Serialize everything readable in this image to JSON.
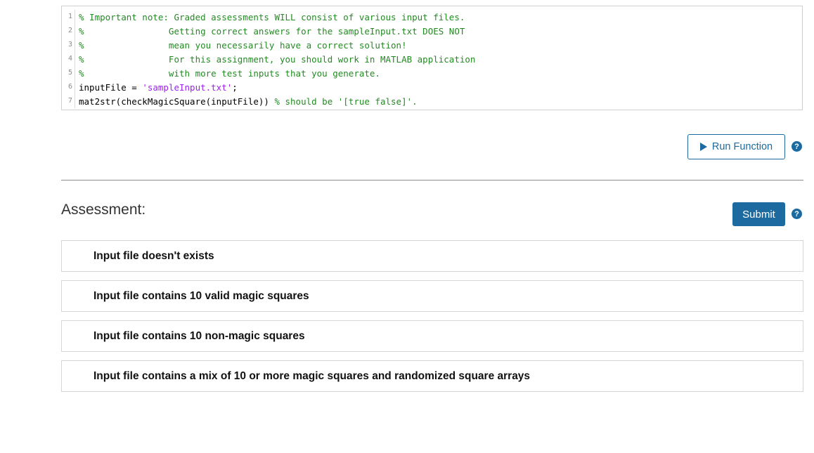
{
  "code": {
    "lines": [
      {
        "num": "1",
        "parts": [
          {
            "cls": "cmt",
            "text": "% Important note: Graded assessments WILL consist of various input files."
          }
        ]
      },
      {
        "num": "2",
        "parts": [
          {
            "cls": "cmt",
            "text": "%                Getting correct answers for the sampleInput.txt DOES NOT"
          }
        ]
      },
      {
        "num": "3",
        "parts": [
          {
            "cls": "cmt",
            "text": "%                mean you necessarily have a correct solution!"
          }
        ]
      },
      {
        "num": "4",
        "parts": [
          {
            "cls": "cmt",
            "text": "%                For this assignment, you should work in MATLAB application"
          }
        ]
      },
      {
        "num": "5",
        "parts": [
          {
            "cls": "cmt",
            "text": "%                with more test inputs that you generate."
          }
        ]
      },
      {
        "num": "6",
        "parts": [
          {
            "cls": "txt",
            "text": "inputFile = "
          },
          {
            "cls": "str",
            "text": "'sampleInput.txt'"
          },
          {
            "cls": "txt",
            "text": ";"
          }
        ]
      },
      {
        "num": "7",
        "parts": [
          {
            "cls": "txt",
            "text": "mat2str(checkMagicSquare(inputFile)) "
          },
          {
            "cls": "cmt",
            "text": "% should be '[true false]'."
          }
        ]
      }
    ]
  },
  "run_button": {
    "label": "Run Function"
  },
  "help_icon_glyph": "?",
  "assessment": {
    "title": "Assessment:",
    "submit_label": "Submit",
    "tests": [
      "Input file doesn't exists",
      "Input file contains 10 valid magic squares",
      "Input file contains 10 non-magic squares",
      "Input file contains a mix of 10 or more magic squares and randomized square arrays"
    ]
  },
  "colors": {
    "accent": "#1c6a9f",
    "comment": "#228b22",
    "string": "#a020f0"
  }
}
